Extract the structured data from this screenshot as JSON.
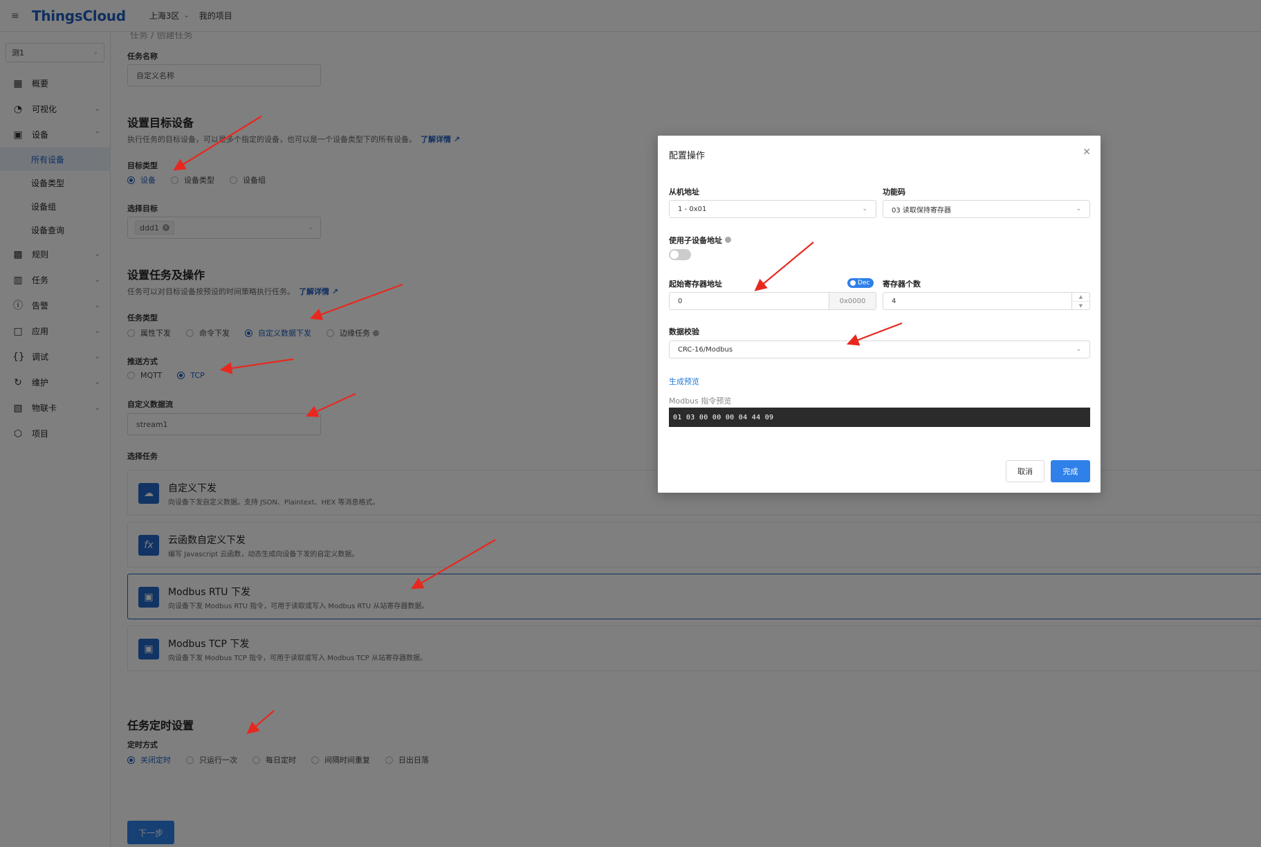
{
  "header": {
    "logo": "ThingsCloud",
    "region": "上海3区",
    "my_project": "我的项目"
  },
  "sidebar": {
    "project_select": "测1",
    "items": [
      {
        "label": "概要",
        "icon": "dashboard-icon"
      },
      {
        "label": "可视化",
        "icon": "gauge-icon"
      },
      {
        "label": "设备",
        "icon": "device-icon"
      },
      {
        "label": "规则",
        "icon": "terminal-icon"
      },
      {
        "label": "任务",
        "icon": "calendar-icon"
      },
      {
        "label": "告警",
        "icon": "alert-icon"
      },
      {
        "label": "应用",
        "icon": "window-icon"
      },
      {
        "label": "调试",
        "icon": "braces-icon"
      },
      {
        "label": "维护",
        "icon": "refresh-icon"
      },
      {
        "label": "物联卡",
        "icon": "sim-card-icon"
      },
      {
        "label": "项目",
        "icon": "cube-icon"
      }
    ],
    "device_sub": [
      "所有设备",
      "设备类型",
      "设备组",
      "设备查询"
    ]
  },
  "form": {
    "crumb": "任务 / 创建任务",
    "task_name_label": "任务名称",
    "task_name_placeholder": "自定义名称",
    "target_title": "设置目标设备",
    "target_desc": "执行任务的目标设备，可以是多个指定的设备，也可以是一个设备类型下的所有设备。",
    "learn_more": "了解详情",
    "target_type_label": "目标类型",
    "target_types": [
      "设备",
      "设备类型",
      "设备组"
    ],
    "select_target_label": "选择目标",
    "selected_target": "ddd1",
    "ops_title": "设置任务及操作",
    "ops_desc": "任务可以对目标设备按预设的时间策略执行任务。",
    "task_type_label": "任务类型",
    "task_types": [
      "属性下发",
      "命令下发",
      "自定义数据下发",
      "边缘任务"
    ],
    "push_label": "推送方式",
    "push_modes": [
      "MQTT",
      "TCP"
    ],
    "stream_label": "自定义数据流",
    "stream_value": "stream1",
    "select_task_label": "选择任务",
    "tasks": [
      {
        "title": "自定义下发",
        "desc": "向设备下发自定义数据。支持 JSON、Plaintext、HEX 等消息格式。",
        "icon": "cloud-upload-icon"
      },
      {
        "title": "云函数自定义下发",
        "desc": "编写 Javascript 云函数，动态生成向设备下发的自定义数据。",
        "icon": "function-icon"
      },
      {
        "title": "Modbus RTU 下发",
        "desc": "向设备下发 Modbus RTU 指令，可用于读取或写入 Modbus RTU 从站寄存器数据。",
        "icon": "modbus-icon"
      },
      {
        "title": "Modbus TCP 下发",
        "desc": "向设备下发 Modbus TCP 指令，可用于读取或写入 Modbus TCP 从站寄存器数据。",
        "icon": "modbus-icon"
      }
    ],
    "schedule_title": "任务定时设置",
    "schedule_label": "定时方式",
    "schedule_modes": [
      "关闭定时",
      "只运行一次",
      "每日定时",
      "间隔时间重复",
      "日出日落"
    ],
    "next_button": "下一步"
  },
  "modal": {
    "title": "配置操作",
    "slave_label": "从机地址",
    "slave_value": "1 - 0x01",
    "func_label": "功能码",
    "func_value": "03 读取保持寄存器",
    "sub_addr_label": "使用子设备地址",
    "start_label": "起始寄存器地址",
    "dec_badge": "Dec",
    "start_value": "0",
    "start_hex": "0x0000",
    "count_label": "寄存器个数",
    "count_value": "4",
    "check_label": "数据校验",
    "check_value": "CRC-16/Modbus",
    "gen_preview": "生成预览",
    "preview_label": "Modbus 指令预览",
    "preview_code": "01 03 00 00 00 04 44 09",
    "cancel": "取消",
    "ok": "完成"
  },
  "colors": {
    "primary": "#2f80e8",
    "brand": "#1f5fbf",
    "annotation_arrow": "#e8281e"
  }
}
